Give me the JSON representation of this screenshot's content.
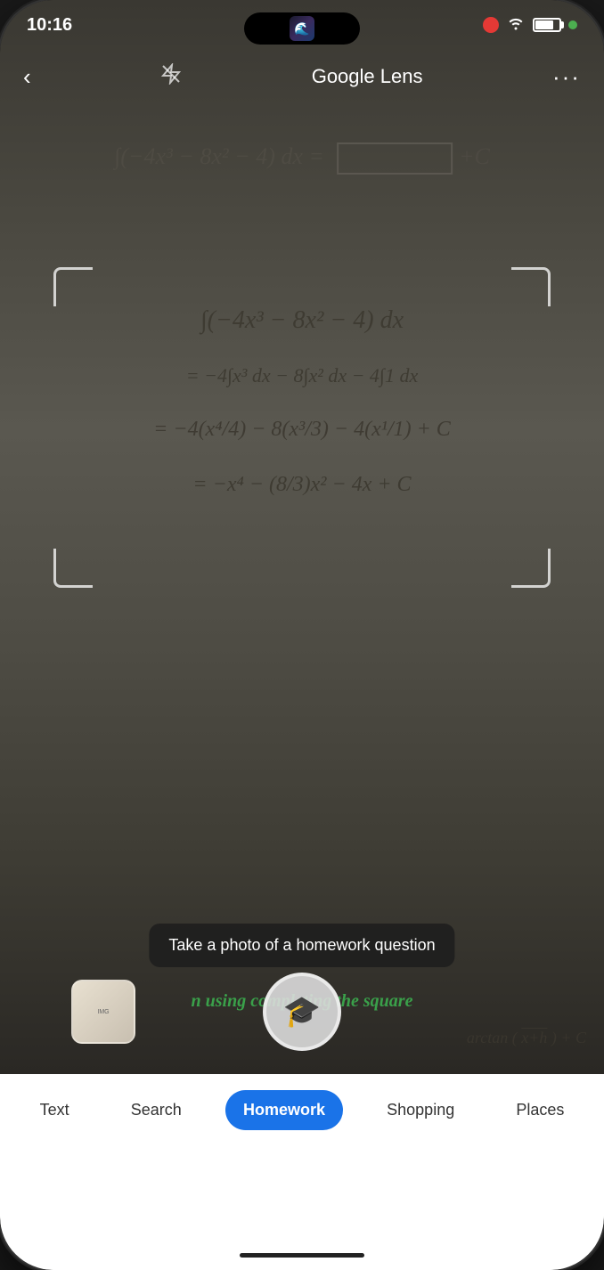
{
  "status": {
    "time": "10:16",
    "wifi": "wifi",
    "battery": "battery",
    "green_dot": true
  },
  "nav": {
    "title": "Google Lens",
    "back_label": "‹",
    "flash_label": "⚡",
    "more_label": "···"
  },
  "tooltip": {
    "text": "Take a photo of a homework question"
  },
  "using_text": "n using completing the square",
  "tabs": [
    {
      "label": "Text",
      "active": false
    },
    {
      "label": "Search",
      "active": false
    },
    {
      "label": "Homework",
      "active": true
    },
    {
      "label": "Shopping",
      "active": false
    },
    {
      "label": "Places",
      "active": false
    }
  ],
  "equations": {
    "top": "∫(−4x³ − 8x² − 4) dx =",
    "eq1": "∫(−4x³ − 8x²  − 4) dx",
    "eq2": "= −4∫x³ dx − 8∫x² dx − 4∫1 dx",
    "eq3": "= −4(x⁴/4) − 8(x³/3) − 4(x¹/1) + C",
    "eq4": "= −x⁴ − (8/3)x² − 4x + C",
    "right": "arctan((x+h)/k) + C"
  }
}
